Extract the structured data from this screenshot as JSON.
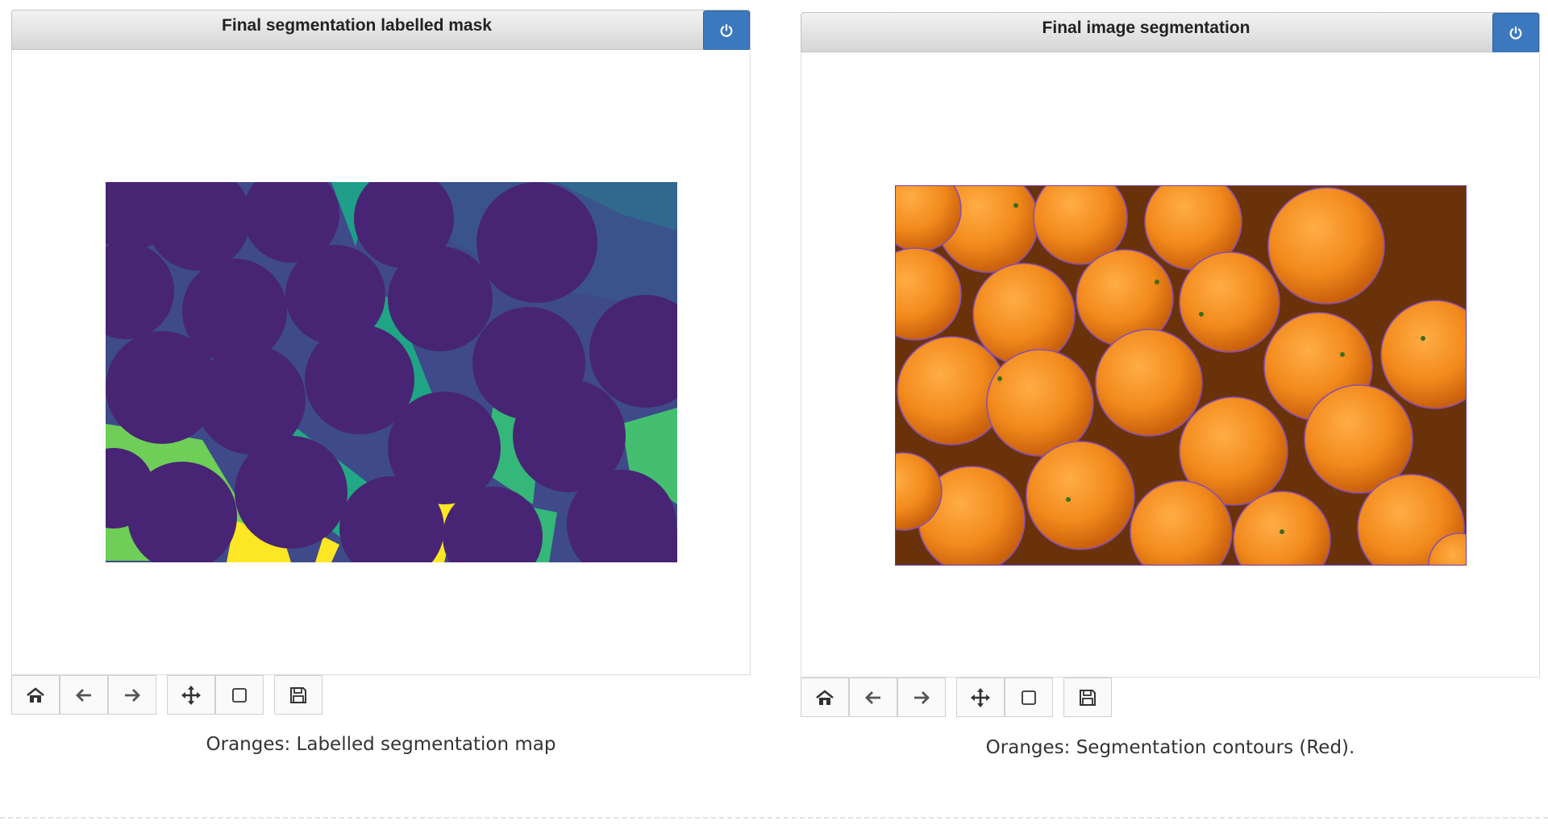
{
  "figures": [
    {
      "title": "Final segmentation labelled mask",
      "caption": "Oranges: Labelled segmentation map"
    },
    {
      "title": "Final image segmentation",
      "caption": "Oranges: Segmentation contours (Red)."
    }
  ],
  "toolbar": {
    "buttons": [
      "home-icon",
      "back-arrow-icon",
      "forward-arrow-icon",
      "move-icon",
      "zoom-rect-icon",
      "save-icon"
    ]
  },
  "colors": {
    "mask_background": "#482474",
    "mask_regions": [
      "#3e4a89",
      "#31688e",
      "#1f9e89",
      "#35b779",
      "#6ece58",
      "#fde725"
    ],
    "orange": "#f08a1c",
    "contour": "#8a4fb0",
    "button_blue": "#3b78be"
  }
}
